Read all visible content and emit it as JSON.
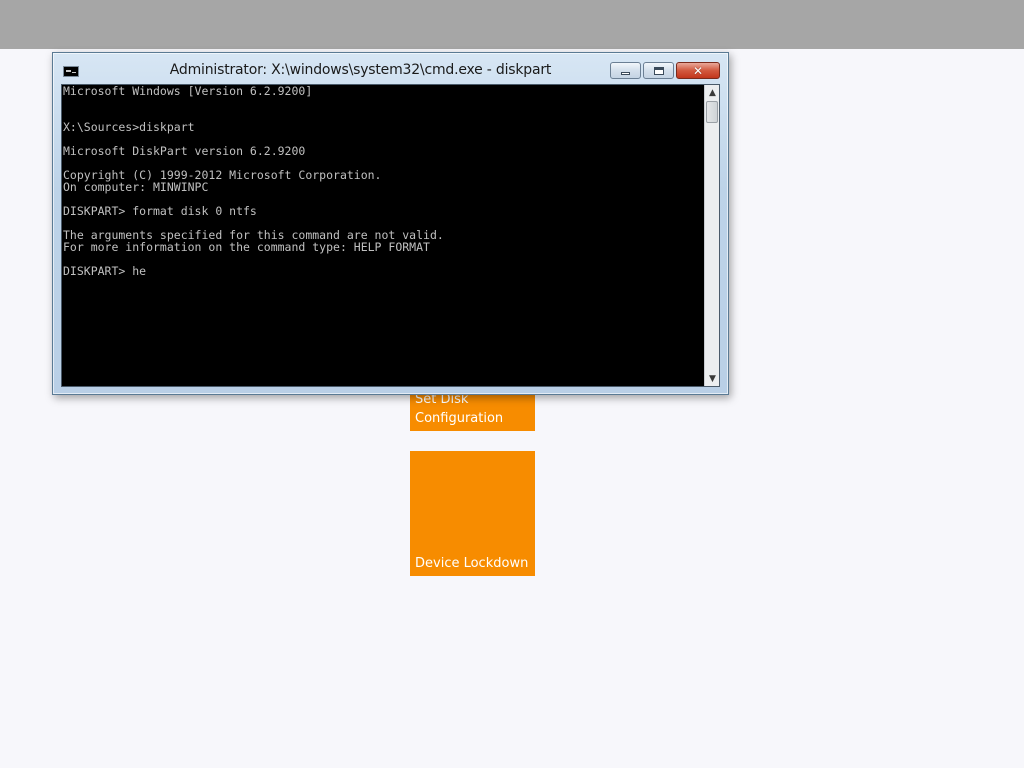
{
  "window": {
    "title": "Administrator: X:\\windows\\system32\\cmd.exe - diskpart",
    "icon": "cmd-icon",
    "buttons": {
      "minimize": "minimize-icon",
      "maximize": "maximize-icon",
      "close": "close-icon",
      "close_glyph": "✕"
    }
  },
  "console": {
    "text": "Microsoft Windows [Version 6.2.9200]\n\n\nX:\\Sources>diskpart\n\nMicrosoft DiskPart version 6.2.9200\n\nCopyright (C) 1999-2012 Microsoft Corporation.\nOn computer: MINWINPC\n\nDISKPART> format disk 0 ntfs\n\nThe arguments specified for this command are not valid.\nFor more information on the command type: HELP FORMAT\n\nDISKPART> he",
    "scroll_up": "▲",
    "scroll_down": "▼"
  },
  "tiles": [
    {
      "label": "Set Disk Configuration",
      "color": "#f78c00"
    },
    {
      "label": "Device Lockdown",
      "color": "#f78c00"
    }
  ],
  "colors": {
    "top_bar": "#a6a6a6",
    "background": "#f7f7fb",
    "console_bg": "#000000",
    "console_fg": "#c0c0c0"
  }
}
